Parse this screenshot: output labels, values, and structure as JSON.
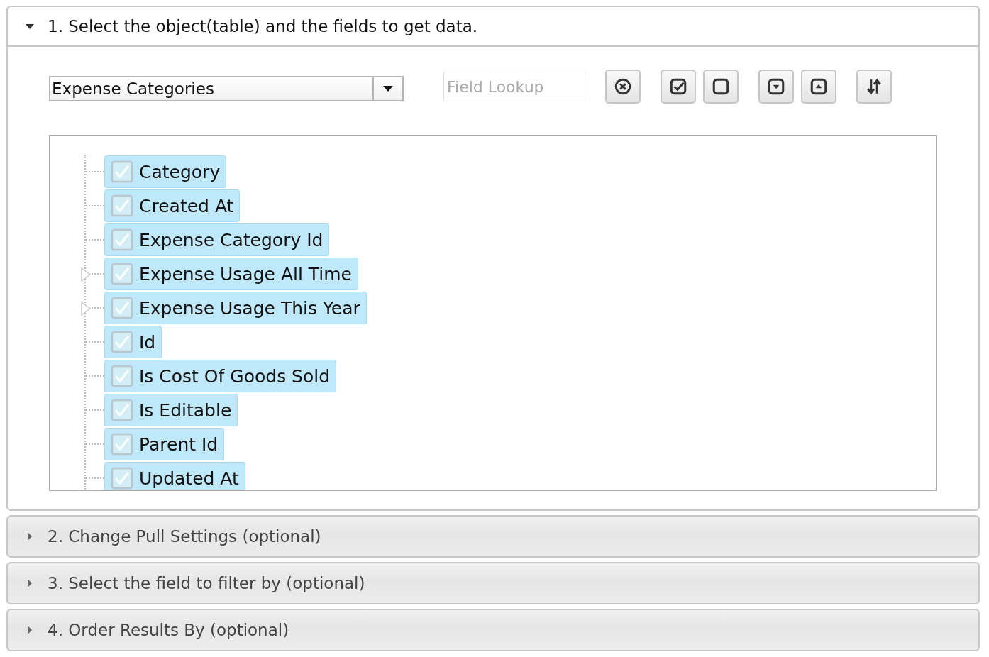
{
  "sections": [
    {
      "title": "1. Select the object(table) and the fields to get data.",
      "expanded": true
    },
    {
      "title": "2. Change Pull Settings (optional)",
      "expanded": false
    },
    {
      "title": "3. Select the field to filter by (optional)",
      "expanded": false
    },
    {
      "title": "4. Order Results By (optional)",
      "expanded": false
    }
  ],
  "object_select": {
    "value": "Expense Categories"
  },
  "field_lookup": {
    "placeholder": "Field Lookup"
  },
  "toolbar": [
    [
      {
        "kind": "clear"
      }
    ],
    [
      {
        "kind": "check-all"
      },
      {
        "kind": "uncheck-all"
      }
    ],
    [
      {
        "kind": "expand-all"
      },
      {
        "kind": "collapse-all"
      }
    ],
    [
      {
        "kind": "sort"
      }
    ]
  ],
  "fields": [
    {
      "label": "Category",
      "checked": true,
      "selected": true,
      "expandable": false
    },
    {
      "label": "Created At",
      "checked": true,
      "selected": true,
      "expandable": false
    },
    {
      "label": "Expense Category Id",
      "checked": true,
      "selected": true,
      "expandable": false
    },
    {
      "label": "Expense Usage All Time",
      "checked": true,
      "selected": true,
      "expandable": true
    },
    {
      "label": "Expense Usage This Year",
      "checked": true,
      "selected": true,
      "expandable": true
    },
    {
      "label": "Id",
      "checked": true,
      "selected": true,
      "expandable": false
    },
    {
      "label": "Is Cost Of Goods Sold",
      "checked": true,
      "selected": true,
      "expandable": false
    },
    {
      "label": "Is Editable",
      "checked": true,
      "selected": true,
      "expandable": false
    },
    {
      "label": "Parent Id",
      "checked": true,
      "selected": true,
      "expandable": false
    },
    {
      "label": "Updated At",
      "checked": true,
      "selected": true,
      "expandable": false
    }
  ]
}
